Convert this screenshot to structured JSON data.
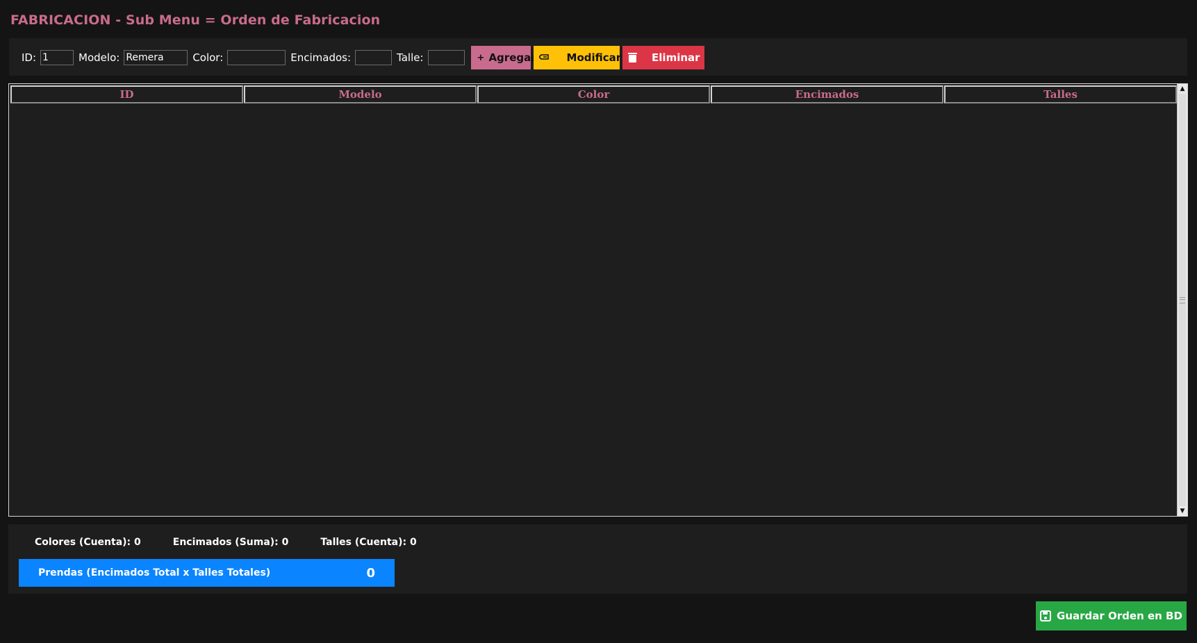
{
  "page": {
    "title": "FABRICACION - Sub Menu = Orden de Fabricacion"
  },
  "form": {
    "id_label": "ID:",
    "id_value": "1",
    "modelo_label": "Modelo:",
    "modelo_value": "Remera",
    "color_label": "Color:",
    "color_value": "",
    "encimados_label": "Encimados:",
    "encimados_value": "",
    "talle_label": "Talle:",
    "talle_value": ""
  },
  "buttons": {
    "add_label": "Agregar",
    "add_icon": "+",
    "modify_label": "Modificar",
    "modify_icon": "pencil-icon",
    "delete_label": "Eliminar",
    "delete_icon": "trash-icon"
  },
  "table": {
    "columns": [
      "ID",
      "Modelo",
      "Color",
      "Encimados",
      "Talles"
    ],
    "rows": []
  },
  "summary": {
    "colores_label": "Colores (Cuenta): 0",
    "encimados_label": "Encimados (Suma): 0",
    "talles_label": "Talles (Cuenta): 0",
    "total_label": "Prendas (Encimados Total x Talles Totales)",
    "total_value": "0"
  },
  "save": {
    "label": "Guardar Orden en BD",
    "icon": "floppy-disk-icon"
  },
  "colors": {
    "accent": "#c96b8d",
    "modify": "#ffc107",
    "delete": "#dc3545",
    "total": "#0a84ff",
    "save": "#28a745",
    "background": "#141414",
    "panel": "#1e1e1e"
  }
}
